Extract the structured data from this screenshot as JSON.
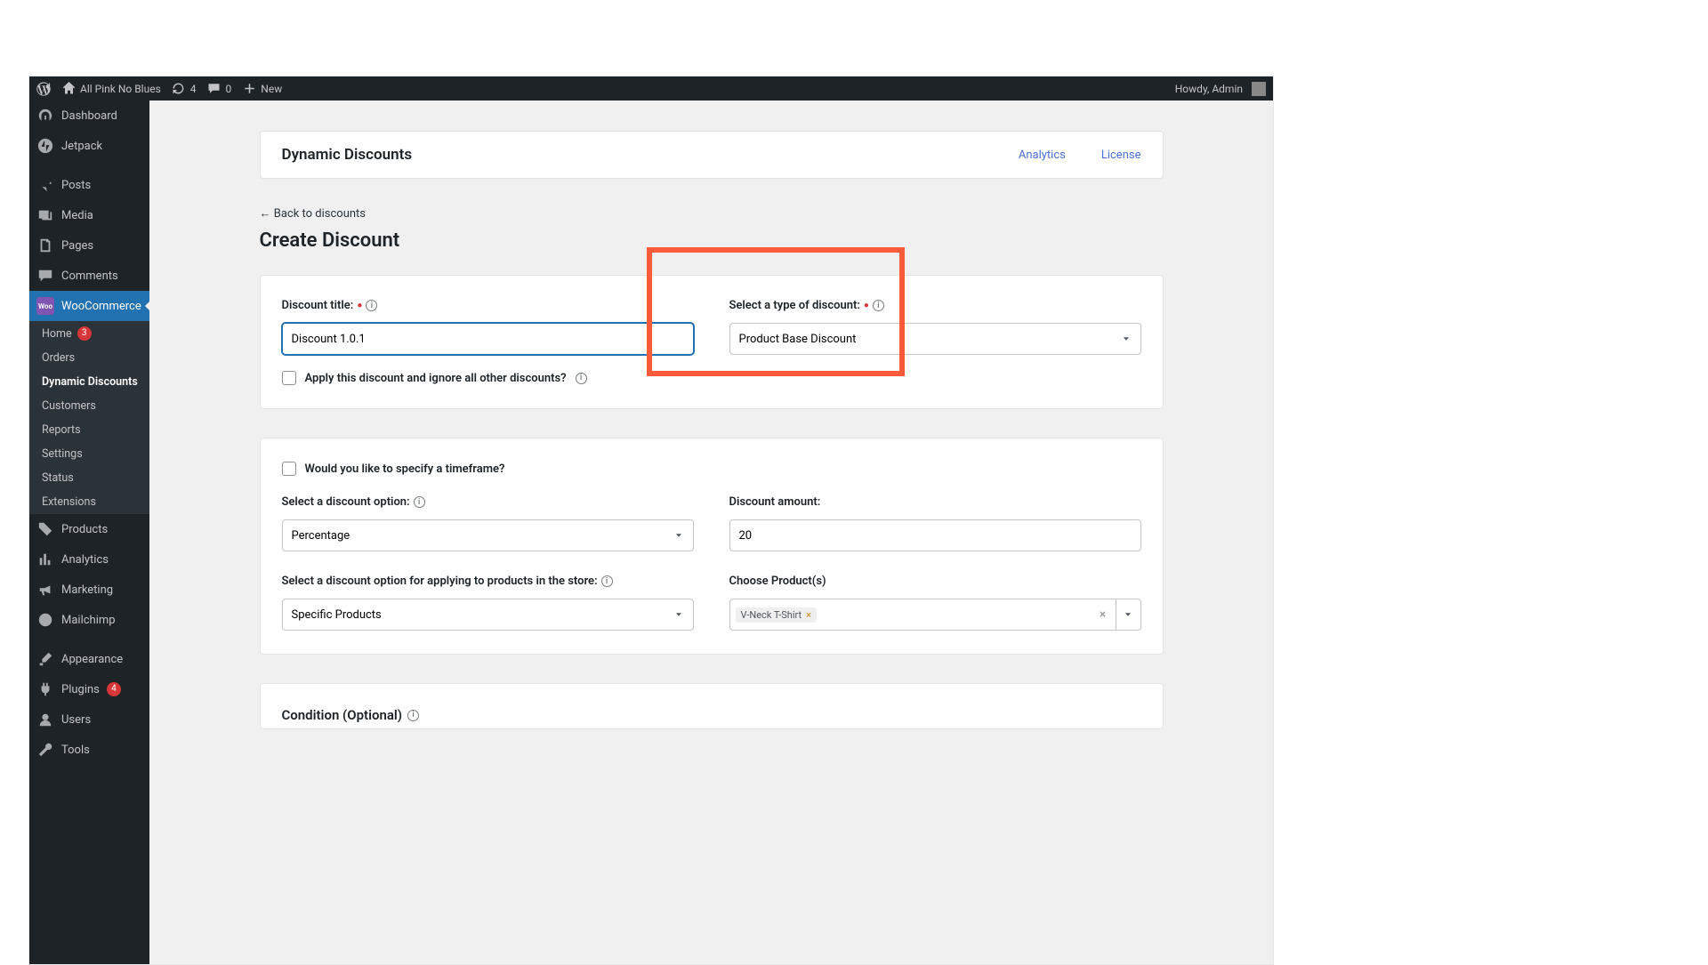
{
  "adminbar": {
    "site_name": "All Pink No Blues",
    "updates_count": "4",
    "comments_count": "0",
    "new_label": "New",
    "howdy": "Howdy, Admin"
  },
  "menu": {
    "dashboard": "Dashboard",
    "jetpack": "Jetpack",
    "posts": "Posts",
    "media": "Media",
    "pages": "Pages",
    "comments": "Comments",
    "woocommerce": "WooCommerce",
    "woo_sub": {
      "home": "Home",
      "home_badge": "3",
      "orders": "Orders",
      "dynamic_discounts": "Dynamic Discounts",
      "customers": "Customers",
      "reports": "Reports",
      "settings": "Settings",
      "status": "Status",
      "extensions": "Extensions"
    },
    "products": "Products",
    "analytics": "Analytics",
    "marketing": "Marketing",
    "mailchimp": "Mailchimp",
    "appearance": "Appearance",
    "plugins": "Plugins",
    "plugins_badge": "4",
    "users": "Users",
    "tools": "Tools"
  },
  "header": {
    "title": "Dynamic Discounts",
    "link_analytics": "Analytics",
    "link_license": "License"
  },
  "page": {
    "back": "← Back to discounts",
    "heading": "Create Discount",
    "condition_heading": "Condition (Optional)"
  },
  "form": {
    "title_label": "Discount title:",
    "title_value": "Discount 1.0.1",
    "type_label": "Select a type of discount:",
    "type_value": "Product Base Discount",
    "ignore_label": "Apply this discount and ignore all other discounts?",
    "timeframe_label": "Would you like to specify a timeframe?",
    "option_label": "Select a discount option:",
    "option_value": "Percentage",
    "amount_label": "Discount amount:",
    "amount_value": "20",
    "apply_label": "Select a discount option for applying to products in the store:",
    "apply_value": "Specific Products",
    "choose_label": "Choose Product(s)",
    "product_tag": "V-Neck T-Shirt"
  }
}
